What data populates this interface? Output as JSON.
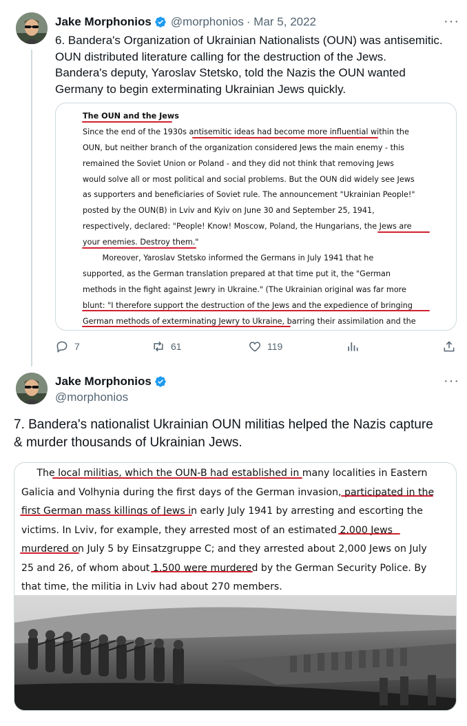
{
  "tweet1": {
    "author_name": "Jake Morphonios",
    "handle": "@morphonios",
    "date": "· Mar 5, 2022",
    "text_lines": [
      "6. Bandera's Organization of Ukrainian Nationalists (OUN) was antisemitic.",
      "OUN distributed literature calling for the destruction of the Jews.",
      "Bandera's deputy, Yaroslav Stetsko, told the Nazis the OUN wanted",
      "Germany to begin exterminating Ukrainian Jews quickly."
    ],
    "document": {
      "heading": "The OUN and the Jews",
      "lines": [
        "Since the end of the 1930s antisemitic ideas had become more influential within the",
        "OUN, but neither branch of the organization considered Jews the main enemy - this",
        "remained the Soviet Union or Poland - and they did not think that removing Jews",
        "would solve all or most political and social problems. But the OUN did widely see Jews",
        "as supporters and beneficiaries of Soviet rule. The announcement \"Ukrainian People!\"",
        "posted by the OUN(B) in Lviv and Kyiv on June 30 and September 25, 1941,",
        "respectively, declared: \"People! Know! Moscow, Poland, the Hungarians, the Jews are",
        "your enemies. Destroy them.\"",
        "        Moreover, Yaroslav Stetsko informed the Germans in July 1941 that he",
        "supported, as the German translation prepared at that time put it, the \"German",
        "methods in the fight against Jewry in Ukraine.\" (The Ukrainian original was far more",
        "blunt: \"I therefore support the destruction of the Jews and the expedience of bringing",
        "German methods of exterminating Jewry to Ukraine, barring their assimilation and the"
      ]
    },
    "stats": {
      "replies": "7",
      "retweets": "61",
      "likes": "119"
    }
  },
  "tweet2": {
    "author_name": "Jake Morphonios",
    "handle": "@morphonios",
    "text_lines": [
      "7. Bandera's nationalist Ukrainian OUN militias helped the Nazis capture",
      "& murder thousands of Ukrainian Jews."
    ],
    "document_lines": [
      "     The local militias, which the OUN-B had established in many localities in Eastern",
      "Galicia and Volhynia during the first days of the German invasion, participated in the",
      "first German mass killings of Jews in early July 1941 by arresting and escorting the",
      "victims. In Lviv, for example, they arrested most of an estimated 2,000 Jews",
      "murdered on July 5 by Einsatzgruppe C; and they arrested about 2,000 Jews on July",
      "25 and 26, of whom about 1,500 were murdered by the German Security Police. By",
      "that time, the militia in Lviv had about 270 members."
    ]
  },
  "colors": {
    "accent_blue": "#1d9bf0",
    "underline_red": "#d0202e",
    "secondary_text": "#536471",
    "border": "#cfd9de"
  },
  "icons": [
    "verified-badge-icon",
    "more-options-icon",
    "reply-icon",
    "retweet-icon",
    "like-icon",
    "views-icon",
    "share-icon"
  ]
}
